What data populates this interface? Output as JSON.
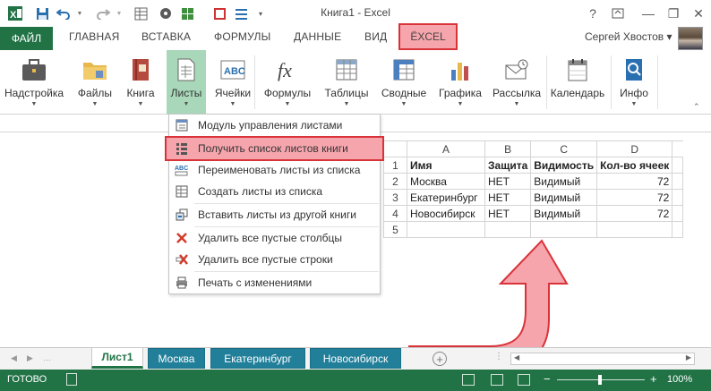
{
  "window": {
    "title": "Книга1 - Excel",
    "help_label": "?",
    "minimize_label": "—",
    "restore_label": "❐",
    "close_label": "✕"
  },
  "ribbon_tabs": {
    "file": "ФАЙЛ",
    "home": "ГЛАВНАЯ",
    "insert": "ВСТАВКА",
    "formulas": "ФОРМУЛЫ",
    "data": "ДАННЫЕ",
    "view": "ВИД",
    "excel": "ЁXCEL"
  },
  "user": {
    "name": "Сергей Хвостов ▾"
  },
  "ribbon_buttons": [
    {
      "label": "Надстройка",
      "icon": "briefcase-icon"
    },
    {
      "label": "Файлы",
      "icon": "folder-icon"
    },
    {
      "label": "Книга",
      "icon": "book-icon"
    },
    {
      "label": "Листы",
      "icon": "sheet-icon"
    },
    {
      "label": "Ячейки",
      "icon": "cells-abc-icon"
    },
    {
      "label": "Формулы",
      "icon": "fx-icon"
    },
    {
      "label": "Таблицы",
      "icon": "table-icon"
    },
    {
      "label": "Сводные",
      "icon": "pivot-icon"
    },
    {
      "label": "Графика",
      "icon": "chart-icon"
    },
    {
      "label": "Рассылка",
      "icon": "mail-icon"
    },
    {
      "label": "Календарь",
      "icon": "calendar-icon"
    },
    {
      "label": "Инфо",
      "icon": "info-icon"
    }
  ],
  "sheets_menu": {
    "items": [
      {
        "label": "Модуль управления листами",
        "icon": "sheet-manager-icon"
      },
      {
        "label": "Получить список листов книги",
        "icon": "list-sheets-icon"
      },
      {
        "label": "Переименовать листы из списка",
        "icon": "rename-abc-icon"
      },
      {
        "label": "Создать листы из списка",
        "icon": "create-sheets-icon"
      },
      {
        "label": "Вставить листы из другой книги",
        "icon": "insert-sheets-icon"
      },
      {
        "label": "Удалить все пустые столбцы",
        "icon": "delete-columns-icon"
      },
      {
        "label": "Удалить все пустые строки",
        "icon": "delete-rows-icon"
      },
      {
        "label": "Печать с изменениями",
        "icon": "print-icon"
      }
    ]
  },
  "grid": {
    "columns": [
      "A",
      "B",
      "C",
      "D"
    ],
    "rows": [
      {
        "num": "1",
        "cells": [
          "Имя",
          "Защита",
          "Видимость",
          "Кол-во ячеек"
        ]
      },
      {
        "num": "2",
        "cells": [
          "Москва",
          "НЕТ",
          "Видимый",
          "72"
        ]
      },
      {
        "num": "3",
        "cells": [
          "Екатеринбург",
          "НЕТ",
          "Видимый",
          "72"
        ]
      },
      {
        "num": "4",
        "cells": [
          "Новосибирск",
          "НЕТ",
          "Видимый",
          "72"
        ]
      },
      {
        "num": "5",
        "cells": [
          "",
          "",
          "",
          ""
        ]
      }
    ]
  },
  "sheet_tabs": [
    "Лист1",
    "Москва",
    "Екатеринбург",
    "Новосибирск"
  ],
  "sheet_add_label": "+",
  "status": {
    "text": "ГОТОВО",
    "zoom": "100%"
  },
  "colors": {
    "excel_green": "#217346",
    "sheet_tab_blue": "#217f9a",
    "highlight_fill": "#f6a5ad",
    "highlight_border": "#d9333a"
  }
}
